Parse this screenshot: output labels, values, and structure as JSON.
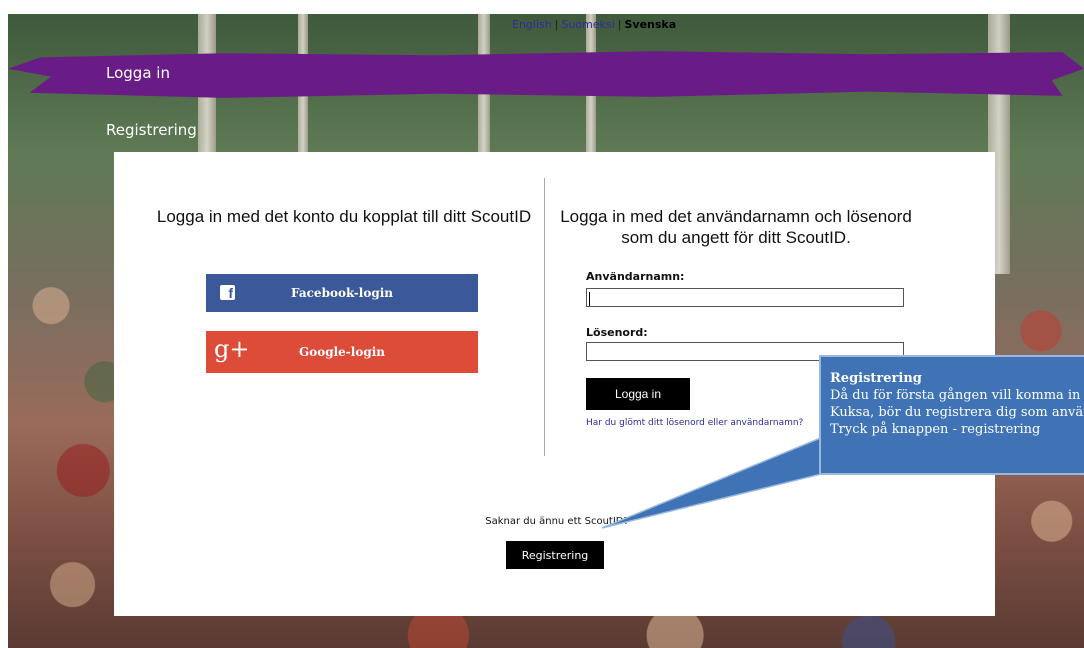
{
  "languages": {
    "english": "English",
    "finnish": "Suomeksi",
    "swedish": "Svenska",
    "separator": "|"
  },
  "nav": {
    "login": "Logga in",
    "register": "Registrering"
  },
  "left_panel": {
    "title": "Logga in med det konto du kopplat till ditt ScoutID",
    "facebook_button": "Facebook-login",
    "google_button": "Google-login"
  },
  "right_panel": {
    "title": "Logga in med det användarnamn och lösenord som du angett för ditt ScoutID.",
    "username_label": "Användarnamn:",
    "username_value": "",
    "password_label": "Lösenord:",
    "password_value": "",
    "login_button": "Logga in",
    "forgot_link": "Har du glömt ditt lösenord eller användarnamn?"
  },
  "register_section": {
    "prompt": "Saknar du ännu ett ScoutID?",
    "button": "Registrering"
  },
  "callout": {
    "title": "Registrering",
    "line1": "Då du för första gången vill komma in i",
    "line2": "Kuksa, bör du registrera dig som användare.",
    "line3": "Tryck på knappen - registrering"
  },
  "colors": {
    "nav_stripe": "#6a1c86",
    "facebook": "#3b5998",
    "google": "#dd4b39",
    "callout": "#3f73b5"
  }
}
